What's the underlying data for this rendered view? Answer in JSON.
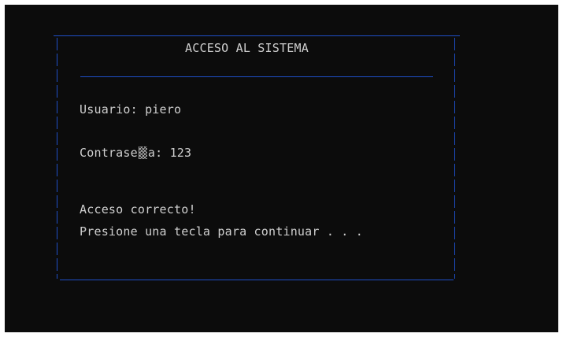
{
  "screen": {
    "title": "ACCESO AL SISTEMA",
    "user_label": "Usuario: ",
    "user_value": "piero",
    "password_label_prefix": "Contrase",
    "password_label_suffix": "a: ",
    "password_value": "123",
    "message_line1": "Acceso correcto!",
    "message_line2": "Presione una tecla para continuar . . ."
  }
}
